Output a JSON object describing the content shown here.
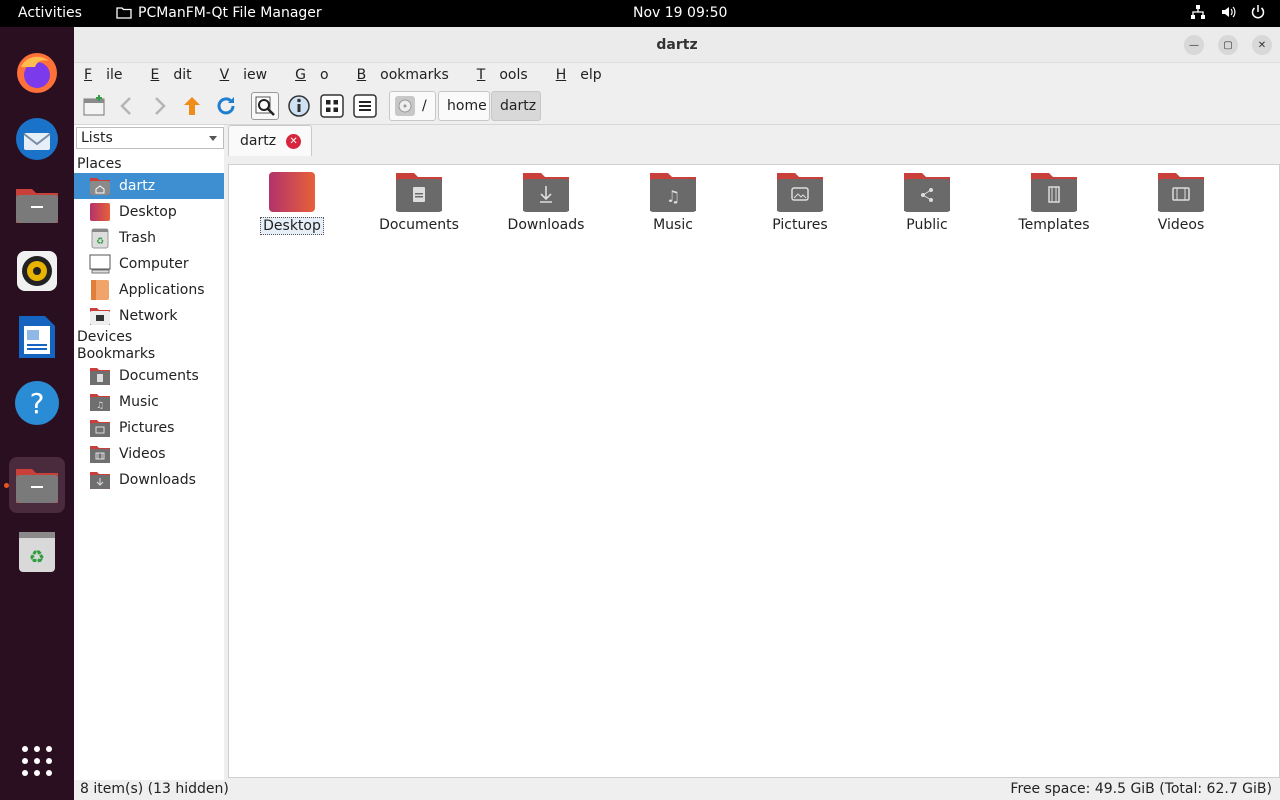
{
  "topbar": {
    "activities": "Activities",
    "app_name": "PCManFM-Qt File Manager",
    "clock": "Nov 19  09:50"
  },
  "window": {
    "title": "dartz"
  },
  "menu": [
    {
      "label": "File",
      "u": "F",
      "rest": "ile"
    },
    {
      "label": "Edit",
      "u": "E",
      "rest": "dit"
    },
    {
      "label": "View",
      "u": "V",
      "rest": "iew"
    },
    {
      "label": "Go",
      "u": "G",
      "rest": "o"
    },
    {
      "label": "Bookmarks",
      "u": "B",
      "rest": "ookmarks"
    },
    {
      "label": "Tools",
      "u": "T",
      "rest": "ools"
    },
    {
      "label": "Help",
      "u": "H",
      "rest": "elp"
    }
  ],
  "breadcrumb": {
    "root": "/",
    "items": [
      "home",
      "dartz"
    ]
  },
  "sidepane": {
    "select_value": "Lists",
    "places_header": "Places",
    "places": [
      "dartz",
      "Desktop",
      "Trash",
      "Computer",
      "Applications",
      "Network"
    ],
    "devices_header": "Devices",
    "bookmarks_header": "Bookmarks",
    "bookmarks": [
      "Documents",
      "Music",
      "Pictures",
      "Videos",
      "Downloads"
    ]
  },
  "tab": {
    "label": "dartz"
  },
  "files": [
    {
      "name": "Desktop",
      "icon": "desktop-folder-icon"
    },
    {
      "name": "Documents",
      "icon": "documents-folder-icon"
    },
    {
      "name": "Downloads",
      "icon": "downloads-folder-icon"
    },
    {
      "name": "Music",
      "icon": "music-folder-icon"
    },
    {
      "name": "Pictures",
      "icon": "pictures-folder-icon"
    },
    {
      "name": "Public",
      "icon": "public-folder-icon"
    },
    {
      "name": "Templates",
      "icon": "templates-folder-icon"
    },
    {
      "name": "Videos",
      "icon": "videos-folder-icon"
    }
  ],
  "status": {
    "items": "8 item(s) (13 hidden)",
    "free_space": "Free space: 49.5 GiB (Total: 62.7 GiB)"
  },
  "colors": {
    "selection": "#3d8fd1",
    "folder_body": "#6a6a6a",
    "folder_tab": "#c9403a",
    "accent": "#e95420"
  }
}
